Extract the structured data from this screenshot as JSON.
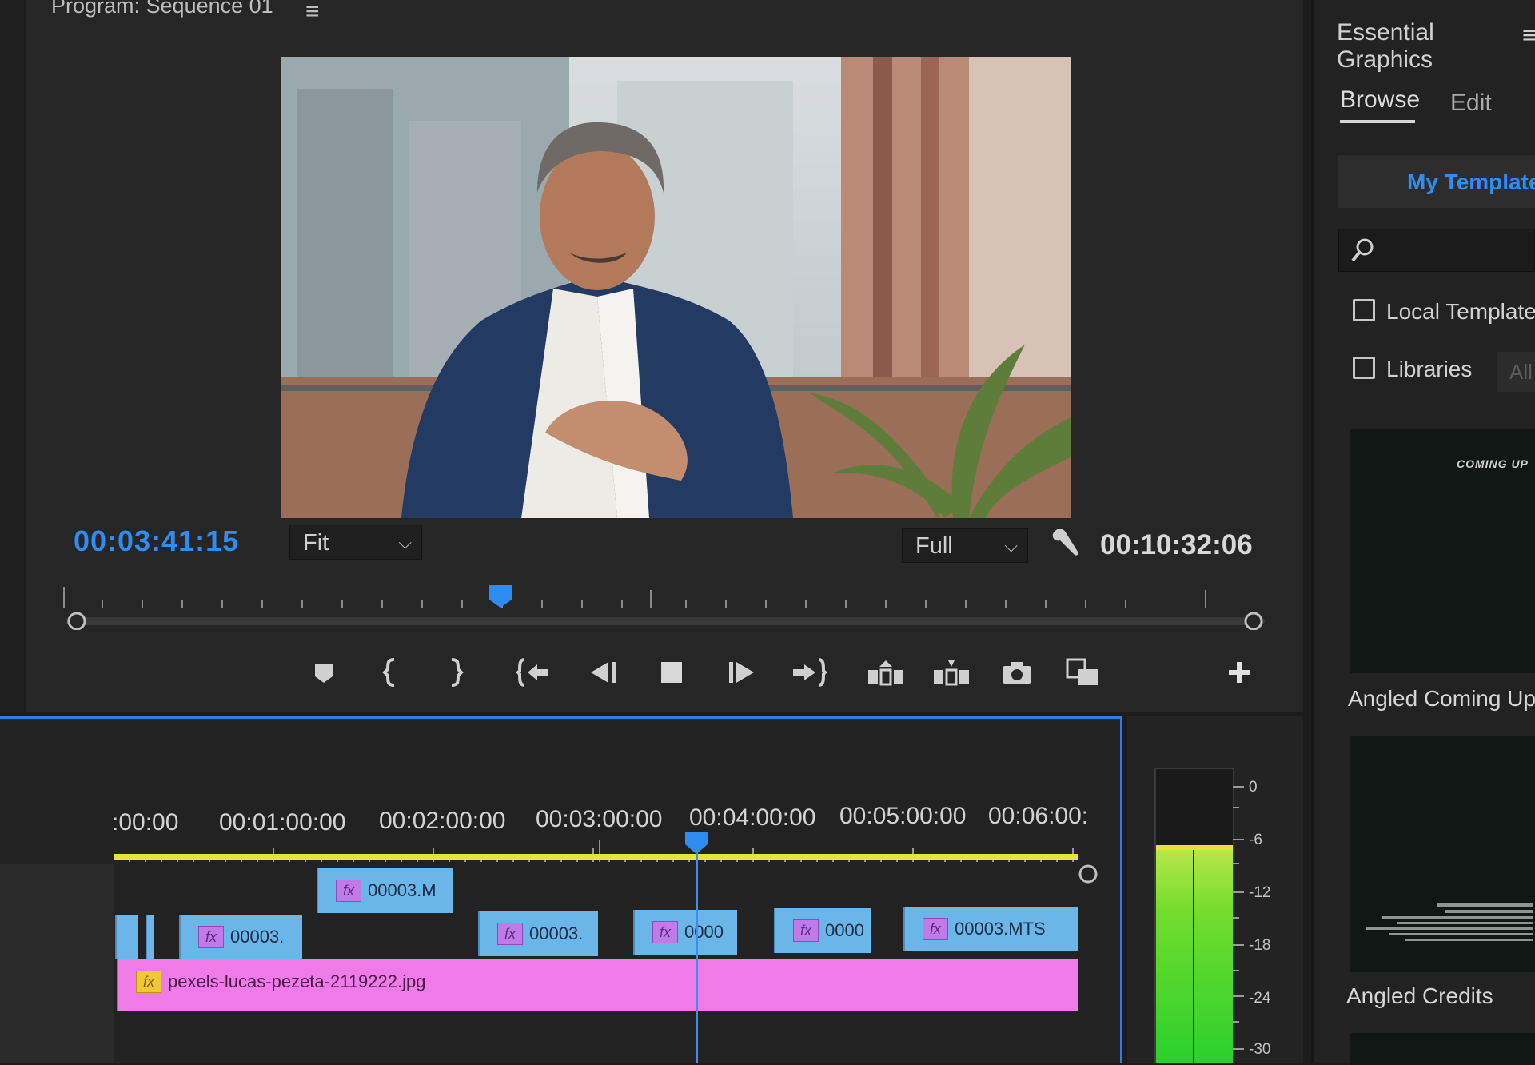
{
  "program_monitor": {
    "title": "Program: Sequence 01",
    "menu_icon": "hamburger-menu-icon",
    "current_timecode": "00:03:41:15",
    "zoom_value": "Fit",
    "resolution_value": "Full",
    "duration_timecode": "00:10:32:06",
    "playhead_progress": 0.36,
    "transport_icons": [
      "add-marker-icon",
      "mark-in-icon",
      "mark-out-icon",
      "go-to-in-icon",
      "step-back-icon",
      "stop-icon",
      "step-forward-icon",
      "go-to-out-icon",
      "lift-icon",
      "extract-icon",
      "export-frame-icon",
      "comparison-view-icon",
      "add-button-icon"
    ]
  },
  "timeline": {
    "ruler_labels": [
      ":00:00",
      "00:01:00:00",
      "00:02:00:00",
      "00:03:00:00",
      "00:04:00:00",
      "00:05:00:00",
      "00:06:00:"
    ],
    "clips_v2": [
      {
        "label": "00003.M"
      }
    ],
    "clips_v1": [
      {
        "label": "00003."
      },
      {
        "label": "00003."
      },
      {
        "label": "0000"
      },
      {
        "label": "0000"
      },
      {
        "label": "00003.MTS"
      }
    ],
    "image_clip": {
      "label": "pexels-lucas-pezeta-2119222.jpg"
    },
    "fx_badge": "fx"
  },
  "audio_meter": {
    "db_labels": [
      "0",
      "-6",
      "-12",
      "-18",
      "-24",
      "-30"
    ],
    "level_db": -6
  },
  "essential_graphics": {
    "title": "Essential Graphics",
    "tabs": {
      "browse": "Browse",
      "edit": "Edit"
    },
    "my_templates": "My Templates",
    "search_placeholder": "",
    "local_templates": "Local Templates",
    "libraries": "Libraries",
    "all_dropdown": "All",
    "templates": [
      {
        "name": "Angled Coming Up N",
        "thumb_text": "COMING UP"
      },
      {
        "name": "Angled Credits"
      }
    ]
  },
  "colors": {
    "accent": "#2f8cf0",
    "clip_blue": "#6bb6e8",
    "clip_pink": "#ee7be8",
    "work_area": "#e7e33a",
    "meter_green": "#2ad02c"
  }
}
